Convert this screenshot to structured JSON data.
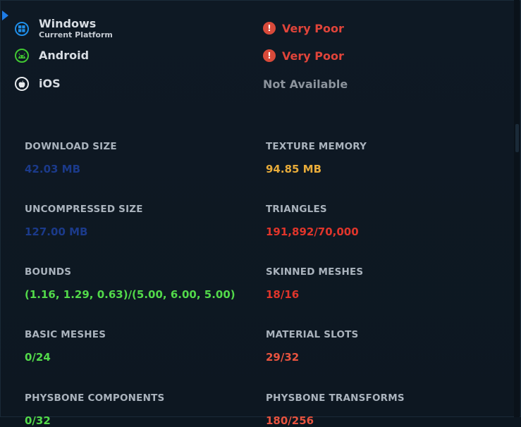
{
  "platforms": [
    {
      "name": "Windows",
      "subtitle": "Current Platform",
      "icon": "windows-icon",
      "rating": "Very Poor",
      "rating_color": "#e0443a",
      "icon_color": "#1f8ee8"
    },
    {
      "name": "Android",
      "subtitle": "",
      "icon": "android-icon",
      "rating": "Very Poor",
      "rating_color": "#e0443a",
      "icon_color": "#41c832"
    },
    {
      "name": "iOS",
      "subtitle": "",
      "icon": "apple-icon",
      "rating": "Not Available",
      "rating_color": "#8b939c",
      "icon_color": "#e6e9ec"
    }
  ],
  "stats": {
    "download_size": {
      "label": "DOWNLOAD SIZE",
      "value": "42.03 MB",
      "color": "#1b3a8a"
    },
    "texture_memory": {
      "label": "TEXTURE MEMORY",
      "value": "94.85 MB",
      "color": "#e7ab3a"
    },
    "uncompressed_size": {
      "label": "UNCOMPRESSED SIZE",
      "value": "127.00 MB",
      "color": "#1b3a8a"
    },
    "triangles": {
      "label": "TRIANGLES",
      "value": "191,892/70,000",
      "color": "#e0352b"
    },
    "bounds": {
      "label": "BOUNDS",
      "value": "(1.16, 1.29, 0.63)/(5.00, 6.00, 5.00)",
      "color": "#52d94a"
    },
    "skinned_meshes": {
      "label": "SKINNED MESHES",
      "value": "18/16",
      "color": "#e0352b"
    },
    "basic_meshes": {
      "label": "BASIC MESHES",
      "value": "0/24",
      "color": "#52d94a"
    },
    "material_slots": {
      "label": "MATERIAL SLOTS",
      "value": "29/32",
      "color": "#e7533f"
    },
    "physbone_components": {
      "label": "PHYSBONE COMPONENTS",
      "value": "0/32",
      "color": "#52d94a"
    },
    "physbone_transforms": {
      "label": "PHYSBONE TRANSFORMS",
      "value": "180/256",
      "color": "#e7533f"
    }
  }
}
